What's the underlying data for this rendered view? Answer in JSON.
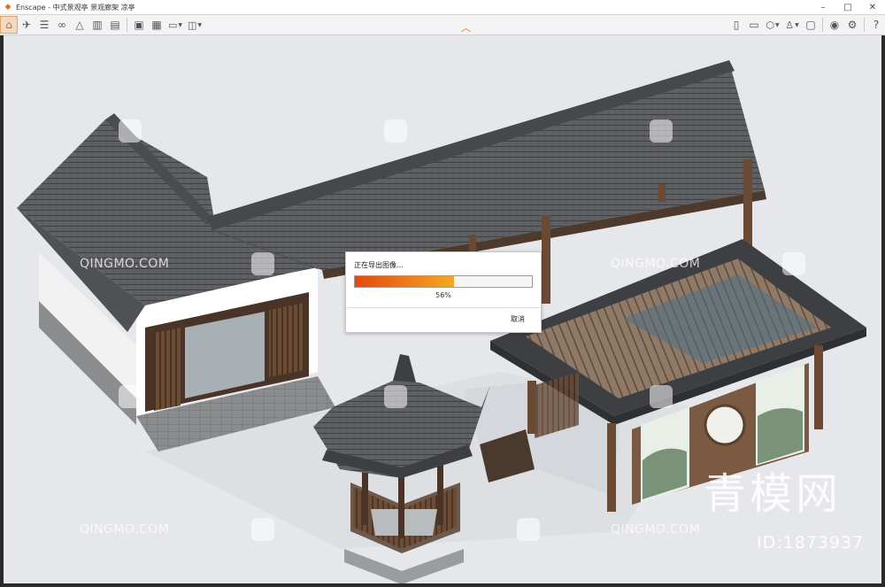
{
  "window": {
    "app_name": "Enscape",
    "title": "Enscape - 中式景观亭 景观廊架 凉亭",
    "controls": [
      "minimize",
      "maximize",
      "close"
    ]
  },
  "toolbar": {
    "left_buttons": [
      "home-icon",
      "paths-icon",
      "list-icon",
      "binoculars-icon",
      "mountain-icon",
      "buildings-icon",
      "panel-icon"
    ],
    "export_buttons": [
      "image-export-icon",
      "batch-export-icon",
      "video-export-icon",
      "panorama-export-icon"
    ],
    "right_buttons": [
      "book-icon",
      "screenshot-icon",
      "cube-icon",
      "vr-icon",
      "display-icon",
      "eye-icon",
      "settings-icon",
      "help-icon"
    ],
    "help_label": "?"
  },
  "dialog": {
    "title": "正在导出图像...",
    "progress": 0.56,
    "percent_text": "56%",
    "cancel_label": "取消"
  },
  "watermarks": {
    "text": "QINGMO.COM",
    "brand": "青模网",
    "id": "ID:1873937"
  },
  "colors": {
    "accent": "#e8711d",
    "progress_start": "#e5480f",
    "progress_end": "#f6a820"
  }
}
